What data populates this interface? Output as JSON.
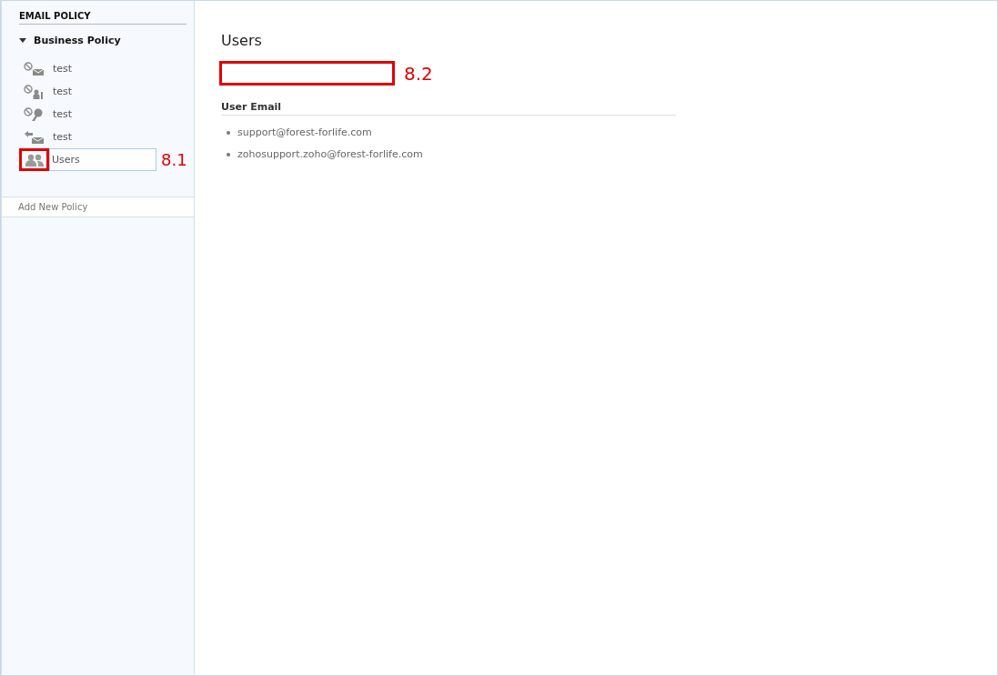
{
  "sidebar": {
    "heading": "EMAIL POLICY",
    "group": {
      "label": "Business Policy",
      "expanded": true,
      "items": [
        {
          "label": "test",
          "kind": "block-mail",
          "selected": false
        },
        {
          "label": "test",
          "kind": "block-person",
          "selected": false
        },
        {
          "label": "test",
          "kind": "block-key",
          "selected": false
        },
        {
          "label": "test",
          "kind": "reply-mail",
          "selected": false
        },
        {
          "label": "Users",
          "kind": "users",
          "selected": true,
          "callout": "8.1"
        }
      ]
    },
    "add_link": "Add New Policy"
  },
  "main": {
    "title": "Users",
    "callout": "8.2",
    "section_heading": "User Email",
    "emails": [
      "support@forest-forlife.com",
      "zohosupport.zoho@forest-forlife.com"
    ]
  }
}
